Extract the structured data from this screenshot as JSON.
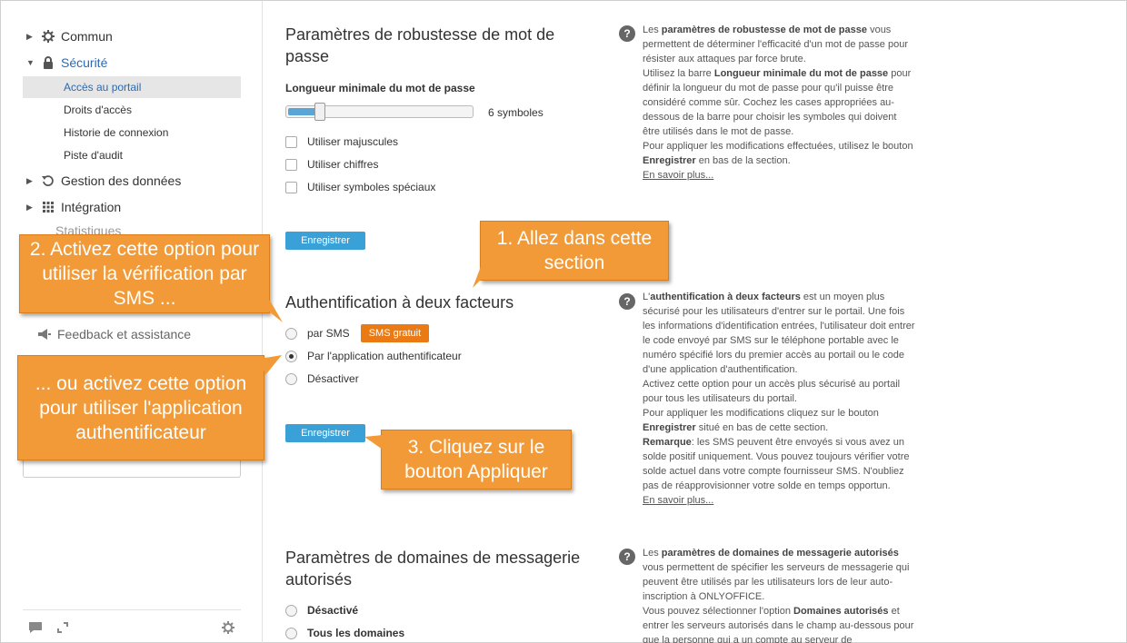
{
  "sidebar": {
    "items": [
      {
        "label": "Commun",
        "icon": "gear-icon"
      },
      {
        "label": "Sécurité",
        "icon": "lock-icon"
      },
      {
        "label": "Gestion des données",
        "icon": "restore-icon"
      },
      {
        "label": "Intégration",
        "icon": "grid-icon"
      }
    ],
    "sub_items": [
      "Accès au portail",
      "Droits d'accès",
      "Historie de connexion",
      "Piste d'audit"
    ],
    "obscured_item": "Statistiques",
    "feedback_label": "Feedback et assistance"
  },
  "password": {
    "title": "Paramètres de robustesse de mot de passe",
    "length_label": "Longueur minimale du mot de passe",
    "slider_value": "6 symboles",
    "slider_fraction": 0.18,
    "options": [
      "Utiliser majuscules",
      "Utiliser chiffres",
      "Utiliser symboles spéciaux"
    ],
    "save_label": "Enregistrer"
  },
  "twofactor": {
    "title": "Authentification à deux facteurs",
    "options": [
      "par SMS",
      "Par l'application authentificateur",
      "Désactiver"
    ],
    "badge": "SMS gratuit",
    "save_label": "Enregistrer"
  },
  "domains": {
    "title": "Paramètres de domaines de messagerie autorisés",
    "options": [
      "Désactivé",
      "Tous les domaines"
    ]
  },
  "help": {
    "password": {
      "lines": [
        "Les <b>paramètres de robustesse de mot de passe</b> vous permettent de déterminer l'efficacité d'un mot de passe pour résister aux attaques par force brute.",
        "Utilisez la barre <b>Longueur minimale du mot de passe</b> pour définir la longueur du mot de passe pour qu'il puisse être considéré comme sûr. Cochez les cases appropriées au-dessous de la barre pour choisir les symboles qui doivent être utilisés dans le mot de passe.",
        "Pour appliquer les modifications effectuées, utilisez le bouton <b>Enregistrer</b> en bas de la section."
      ],
      "link": "En savoir plus..."
    },
    "twofactor": {
      "lines": [
        "L'<b>authentification à deux facteurs</b> est un moyen plus sécurisé pour les utilisateurs d'entrer sur le portail. Une fois les informations d'identification entrées, l'utilisateur doit entrer le code envoyé par SMS sur le téléphone portable avec le numéro spécifié lors du premier accès au portail ou le code d'une application d'authentification.",
        "Activez cette option pour un accès plus sécurisé au portail pour tous les utilisateurs du portail.",
        "Pour appliquer les modifications cliquez sur le bouton <b>Enregistrer</b> situé en bas de cette section.",
        "<b>Remarque</b>: les SMS peuvent être envoyés si vous avez un solde positif uniquement. Vous pouvez toujours vérifier votre solde actuel dans votre compte fournisseur SMS. N'oubliez pas de réapprovisionner votre solde en temps opportun."
      ],
      "link": "En savoir plus..."
    },
    "domains": {
      "lines": [
        "Les <b>paramètres de domaines de messagerie autorisés</b> vous permettent de spécifier les serveurs de messagerie qui peuvent être utilisés par les utilisateurs lors de leur auto-inscription à ONLYOFFICE.",
        "Vous pouvez sélectionner l'option <b>Domaines autorisés</b> et entrer les serveurs autorisés dans le champ au-dessous pour que la personne qui a un compte au serveur de"
      ]
    }
  },
  "callouts": {
    "c1": "1. Allez dans cette section",
    "c2": "2. Activez cette option pour utiliser la vérification par SMS ...",
    "c3": "... ou activez cette option pour utiliser l'application authentificateur",
    "c4": "3. Cliquez sur le bouton Appliquer"
  },
  "colors": {
    "accent": "#3aa0d8",
    "badge": "#ea7b14",
    "callout": "#f29a38",
    "link": "#2a6bb3"
  }
}
